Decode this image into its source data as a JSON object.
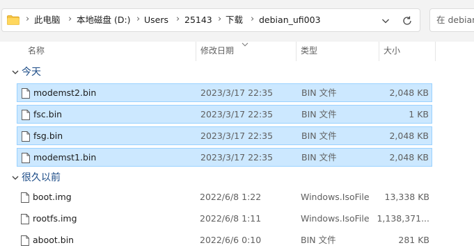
{
  "address_bar": {
    "breadcrumbs": [
      "此电脑",
      "本地磁盘 (D:)",
      "Users",
      "25143",
      "下载",
      "debian_ufi003"
    ],
    "folder_icon": "folder-icon",
    "dropdown_icon": "chevron-down-icon",
    "refresh_icon": "refresh-icon"
  },
  "search": {
    "placeholder": "在 debian"
  },
  "columns": {
    "name": "名称",
    "date": "修改日期",
    "type": "类型",
    "size": "大小"
  },
  "groups": [
    {
      "label": "今天",
      "files": [
        {
          "name": "modemst2.bin",
          "date": "2023/3/17 22:35",
          "type": "BIN 文件",
          "size": "2,048 KB",
          "selected": true
        },
        {
          "name": "fsc.bin",
          "date": "2023/3/17 22:35",
          "type": "BIN 文件",
          "size": "1 KB",
          "selected": true
        },
        {
          "name": "fsg.bin",
          "date": "2023/3/17 22:35",
          "type": "BIN 文件",
          "size": "2,048 KB",
          "selected": true
        },
        {
          "name": "modemst1.bin",
          "date": "2023/3/17 22:35",
          "type": "BIN 文件",
          "size": "2,048 KB",
          "selected": true
        }
      ]
    },
    {
      "label": "很久以前",
      "files": [
        {
          "name": "boot.img",
          "date": "2022/6/8 1:22",
          "type": "Windows.IsoFile",
          "size": "13,338 KB",
          "selected": false
        },
        {
          "name": "rootfs.img",
          "date": "2022/6/8 1:11",
          "type": "Windows.IsoFile",
          "size": "1,138,371...",
          "selected": false
        },
        {
          "name": "aboot.bin",
          "date": "2022/6/6 0:10",
          "type": "BIN 文件",
          "size": "281 KB",
          "selected": false
        }
      ]
    }
  ],
  "colors": {
    "selection_bg": "#cce8ff",
    "selection_border": "#99d1ff",
    "group_label": "#1a4a86",
    "folder_yellow": "#f4c242"
  }
}
